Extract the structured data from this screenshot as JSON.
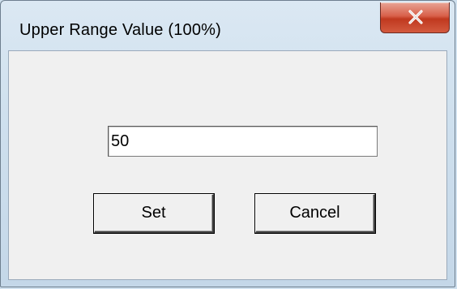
{
  "window": {
    "title": "Upper Range Value (100%)",
    "close_icon": "close-icon"
  },
  "form": {
    "value": "50"
  },
  "buttons": {
    "set_label": "Set",
    "cancel_label": "Cancel"
  },
  "colors": {
    "close_button": "#c8452c",
    "dialog_face": "#f0f0f0",
    "frame": "#cfe0ee"
  }
}
